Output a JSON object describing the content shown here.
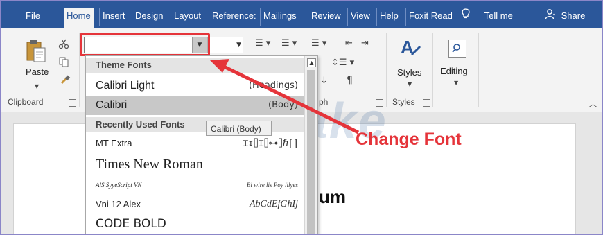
{
  "tabs": [
    {
      "label": "File"
    },
    {
      "label": "Home"
    },
    {
      "label": "Insert"
    },
    {
      "label": "Design"
    },
    {
      "label": "Layout"
    },
    {
      "label": "Reference:"
    },
    {
      "label": "Mailings"
    },
    {
      "label": "Review"
    },
    {
      "label": "View"
    },
    {
      "label": "Help"
    },
    {
      "label": "Foxit Read"
    }
  ],
  "tellme": {
    "label": "Tell me",
    "icon": "lightbulb-icon"
  },
  "share": {
    "label": "Share",
    "icon": "person-icon"
  },
  "clipboard": {
    "paste_label": "Paste",
    "group_label": "Clipboard"
  },
  "font": {
    "current_value": "",
    "size_value": ""
  },
  "paragraph": {
    "group_label_fragment": "ph"
  },
  "styles": {
    "label": "Styles",
    "group_label": "Styles"
  },
  "editing": {
    "label": "Editing"
  },
  "dropdown": {
    "theme_header": "Theme Fonts",
    "theme_fonts": [
      {
        "name": "Calibri Light",
        "tag": "(Headings)"
      },
      {
        "name": "Calibri",
        "tag": "(Body)",
        "selected": true
      }
    ],
    "recent_header": "Recently Used Fonts",
    "recent_fonts": [
      {
        "name": "MT Extra",
        "preview": "⌶↧⌷⌶⌷⊶⌷ℏ⌈⌉"
      },
      {
        "name": "Times New Roman",
        "preview": ""
      },
      {
        "name": "AlS SyyeScript VN",
        "preview": "Bi wire lis Poy lilyes"
      },
      {
        "name": "Vni 12 Alex",
        "preview": "AbCdEfGhIj"
      },
      {
        "name": "CODE BOLD",
        "preview": ""
      }
    ],
    "tooltip": "Calibri (Body)"
  },
  "document": {
    "visible_text": "um"
  },
  "annotation": {
    "label": "Change Font",
    "color": "#e5343a"
  },
  "watermark": {
    "text": "TipsMake"
  },
  "colors": {
    "ribbon_blue": "#2b579a",
    "highlight_red": "#e5343a"
  }
}
